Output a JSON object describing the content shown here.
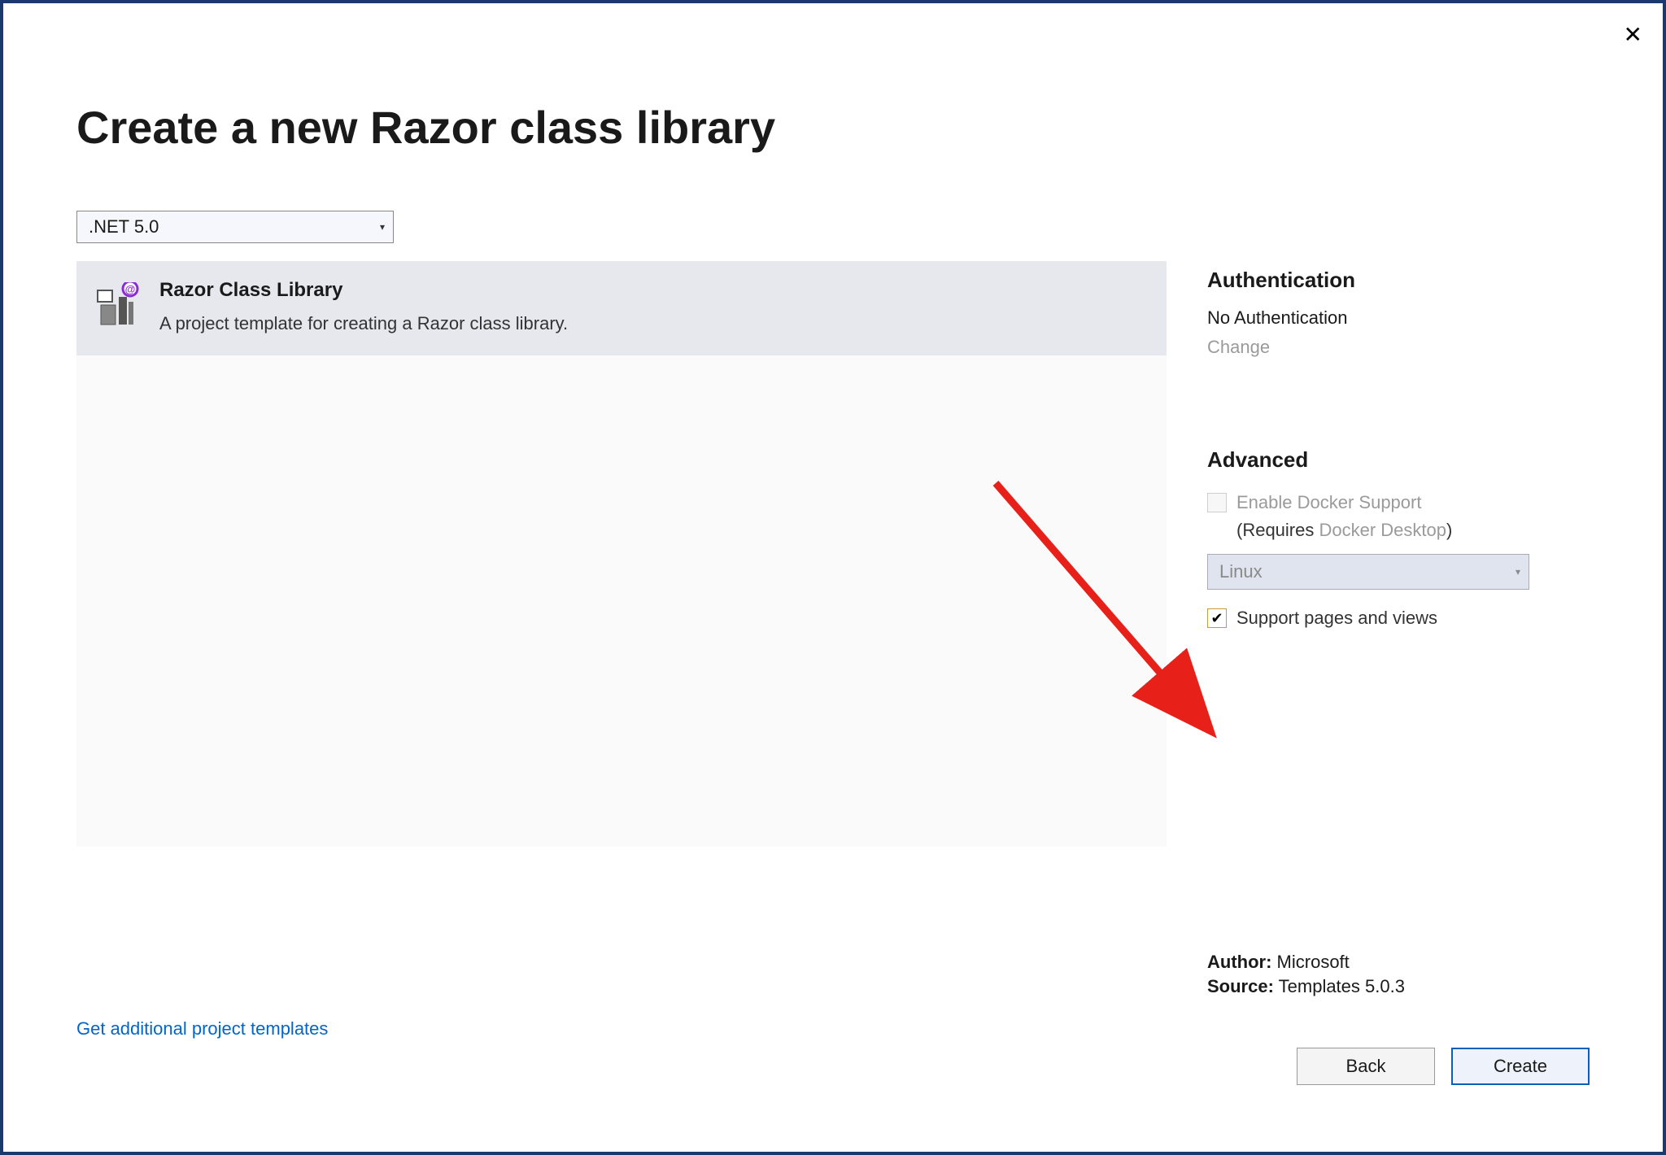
{
  "title": "Create a new Razor class library",
  "framework_selected": ".NET 5.0",
  "template": {
    "name": "Razor Class Library",
    "description": "A project template for creating a Razor class library."
  },
  "authentication": {
    "heading": "Authentication",
    "value": "No Authentication",
    "change_label": "Change"
  },
  "advanced": {
    "heading": "Advanced",
    "docker_label": "Enable Docker Support",
    "requires_prefix": "(Requires ",
    "requires_link": "Docker Desktop",
    "requires_suffix": ")",
    "os_selected": "Linux",
    "support_label": "Support pages and views"
  },
  "meta": {
    "author_label": "Author:",
    "author_value": "Microsoft",
    "source_label": "Source:",
    "source_value": "Templates 5.0.3"
  },
  "link_text": "Get additional project templates",
  "buttons": {
    "back": "Back",
    "create": "Create"
  }
}
